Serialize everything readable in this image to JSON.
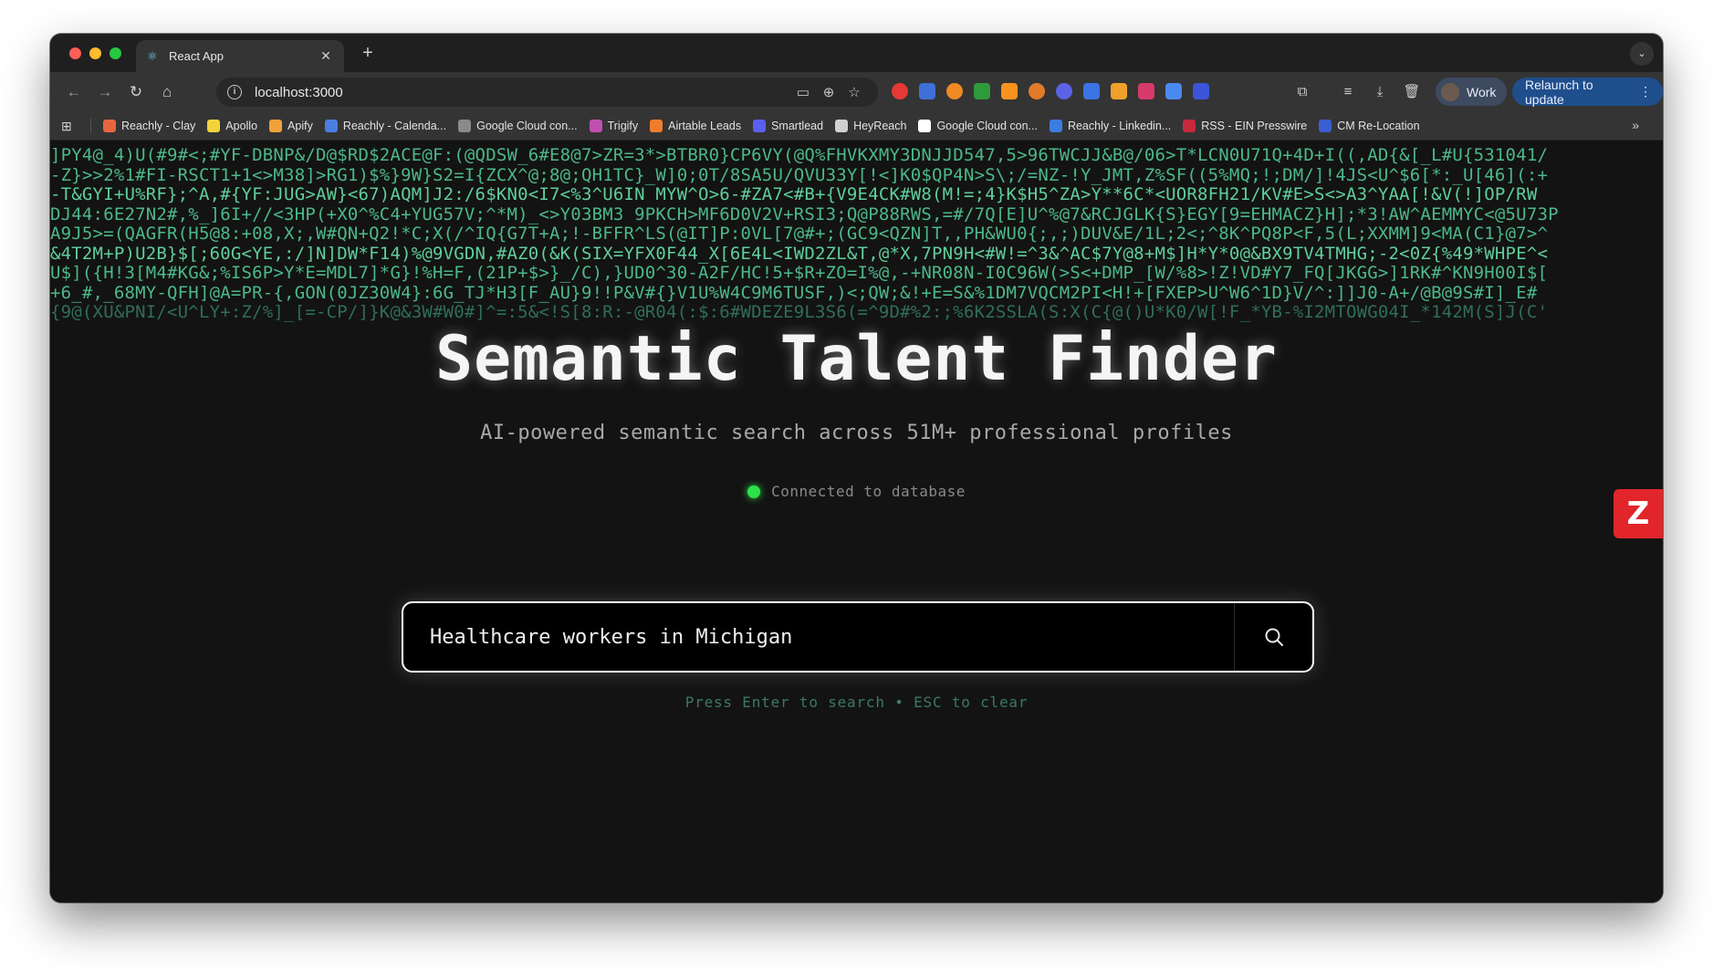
{
  "browser": {
    "tab": {
      "title": "React App",
      "icon": "react-icon"
    },
    "new_tab_label": "+",
    "url": "localhost:3000",
    "profile_label": "Work",
    "relaunch_label": "Relaunch to update",
    "bookmarks": [
      {
        "label": "Reachly - Clay",
        "color": "#e8663d"
      },
      {
        "label": "Apollo",
        "color": "#f2d43a"
      },
      {
        "label": "Apify",
        "color": "#f0a13a"
      },
      {
        "label": "Reachly - Calenda...",
        "color": "#4a7fe0"
      },
      {
        "label": "Google Cloud con...",
        "color": "#8a8a8a"
      },
      {
        "label": "Trigify",
        "color": "#c04fb0"
      },
      {
        "label": "Airtable Leads",
        "color": "#f07c2d"
      },
      {
        "label": "Smartlead",
        "color": "#5b5ff0"
      },
      {
        "label": "HeyReach",
        "color": "#d0d0d0"
      },
      {
        "label": "Google Cloud con...",
        "color": "#ffffff"
      },
      {
        "label": "Reachly - Linkedin...",
        "color": "#3b7de0"
      },
      {
        "label": "RSS - EIN Presswire",
        "color": "#c8283c"
      },
      {
        "label": "CM Re-Location",
        "color": "#3a5fd0"
      }
    ]
  },
  "matrix_rain": [
    "]PY4@_4)U(#9#<;#YF-DBNP&/D@$RD$2ACE@F:(@QDSW_6#E8@7>ZR=3*>BTBR0}CP6VY(@Q%FHVKXMY3DNJJD547,5>96TWCJJ&B@/06>T*LCN0U71Q+4D+I((,AD{&[_L#U{531041/",
    "-Z}>>2%1#FI-RSCT1+1<>M38]>RG1)$%}9W}S2=I{ZCX^@;8@;QH1TC}_W]0;0T/8SA5U/QVU33Y[!<]K0$QP4N>S\\;/=NZ-!Y_JMT,Z%SF((5%MQ;!;DM/]!4JS<U^$6[*:_U[46](:+",
    "-T&GYI+U%RF};^A,#{YF:JUG>AW}<67)AQM]J2:/6$KN0<I7<%3^U6IN MYW^O>6-#ZA7<#B+{V9E4CK#W8(M!=;4}K$H5^ZA>Y**6C*<UOR8FH21/KV#E>S<>A3^YAA[!&V(!]OP/RW",
    "DJ44:6E27N2#,%_]6I+//<3HP(+X0^%C4+YUG57V;^*M)_<>Y03BM3 9PKCH>MF6D0V2V+RSI3;Q@P88RWS,=#/7Q[E]U^%@7&RCJGLK{S}EGY[9=EHMACZ}H];*3!AW^AEMMYC<@5U73P",
    "A9J5>=(QAGFR(H5@8:+08,X;,W#QN+Q2!*C;X(/^IQ{G7T+A;!-BFFR^LS(@IT]P:0VL[7@#+;(GC9<QZN]T,,PH&WU0{;,;)DUV&E/1L;2<;^8K^PQ8P<F,5(L;XXMM]9<MA(C1}@7>^",
    "&4T2M+P)U2B}$[;60G<YE,:/]N]DW*F14)%@9VGDN,#AZ0(&K(SIX=YFX0F44_X[6E4L<IWD2ZL&T,@*X,7PN9H<#W!=^3&^AC$7Y@8+M$]H*Y*0@&BX9TV4TMHG;-2<0Z{%49*WHPE^<",
    "U$]({H!3[M4#KG&;%IS6P>Y*E=MDL7]*G}!%H=F,(21P+$>}_/C),}UD0^30-A2F/HC!5+$R+ZO=I%@,-+NR08N-I0C96W(>S<+DMP_[W/%8>!Z!VD#Y7_FQ[JKGG>]1RK#^KN9H00I$[",
    "+6_#,_68MY-QFH]@A=PR-{,GON(0JZ30W4}:6G_TJ*H3[F_AU}9!!P&V#{}V1U%W4C9M6TUSF,)<;QW;&!+E=S&%1DM7VQCM2PI<H!+[FXEP>U^W6^1D}V/^:]]J0-A+/@B@9S#I]_E#",
    "{9@(XU&PNI/<U^LY+:Z/%]_[=-CP/]}K@&3W#W0#]^=:5&<!S[8:R:-@R04(:$:6#WDEZE9L3S6(=^9D#%2:;%6K2SSLA(S:X(C{@()U*K0/W[!F_*YB-%I2MTOWG04I_*142M(S]J(C'"
  ],
  "hero": {
    "title": "Semantic Talent Finder",
    "subtitle": "AI-powered semantic search across 51M+ professional profiles"
  },
  "status": {
    "text": "Connected to database",
    "color": "#2ee04a"
  },
  "search": {
    "value": "Healthcare workers in Michigan",
    "placeholder": "",
    "hint": "Press Enter to search • ESC to clear"
  },
  "floating_extension": {
    "icon": "zoominfo-logo-icon",
    "glyph": "Z",
    "color": "#e1252b"
  }
}
